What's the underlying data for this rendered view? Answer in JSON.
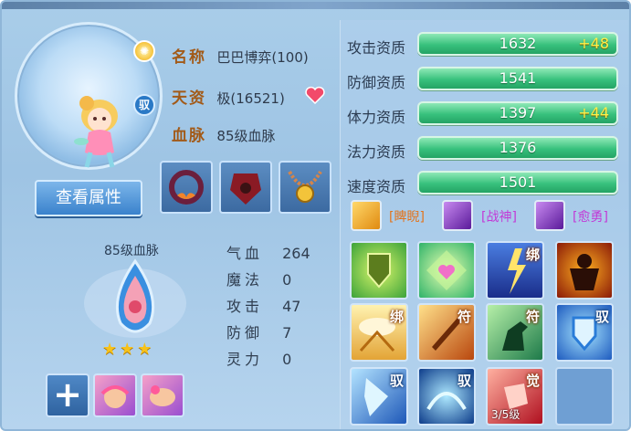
{
  "pet": {
    "name_label": "名称",
    "name_value": "巴巴博弈(100)",
    "talent_label": "天资",
    "talent_value": "极(16521)",
    "bloodline_label": "血脉",
    "bloodline_value": "85级血脉",
    "view_button": "查看属性"
  },
  "bloodline": {
    "title": "85级血脉",
    "stars": "★★★",
    "stats": [
      {
        "label": "气血",
        "value": "264"
      },
      {
        "label": "魔法",
        "value": "0"
      },
      {
        "label": "攻击",
        "value": "47"
      },
      {
        "label": "防御",
        "value": "7"
      },
      {
        "label": "灵力",
        "value": "0"
      }
    ]
  },
  "aptitudes": [
    {
      "label": "攻击资质",
      "value": "1632",
      "bonus": "+48"
    },
    {
      "label": "防御资质",
      "value": "1541",
      "bonus": ""
    },
    {
      "label": "体力资质",
      "value": "1397",
      "bonus": "+44"
    },
    {
      "label": "法力资质",
      "value": "1376",
      "bonus": ""
    },
    {
      "label": "速度资质",
      "value": "1501",
      "bonus": ""
    }
  ],
  "traits": [
    {
      "label": "[睥睨]",
      "color": "#e2741d"
    },
    {
      "label": "[战神]",
      "color": "#c23ad6"
    },
    {
      "label": "[愈勇]",
      "color": "#c23ad6"
    }
  ],
  "skills": [
    {
      "tag": "",
      "level": ""
    },
    {
      "tag": "",
      "level": ""
    },
    {
      "tag": "绑",
      "level": ""
    },
    {
      "tag": "",
      "level": ""
    },
    {
      "tag": "绑",
      "level": ""
    },
    {
      "tag": "符",
      "level": ""
    },
    {
      "tag": "符",
      "level": ""
    },
    {
      "tag": "驭",
      "level": ""
    },
    {
      "tag": "驭",
      "level": ""
    },
    {
      "tag": "驭",
      "level": ""
    },
    {
      "tag": "觉",
      "level": "3/5级"
    },
    {
      "tag": "",
      "level": ""
    }
  ],
  "icons": {
    "sun_badge": "sun-badge-icon",
    "tame_badge": "驭",
    "heart": "heart-icon",
    "add": "+"
  },
  "colors": {
    "label_brown": "#a25a18",
    "bar_green": "#38c17d",
    "bonus_yellow": "#fff04a"
  }
}
